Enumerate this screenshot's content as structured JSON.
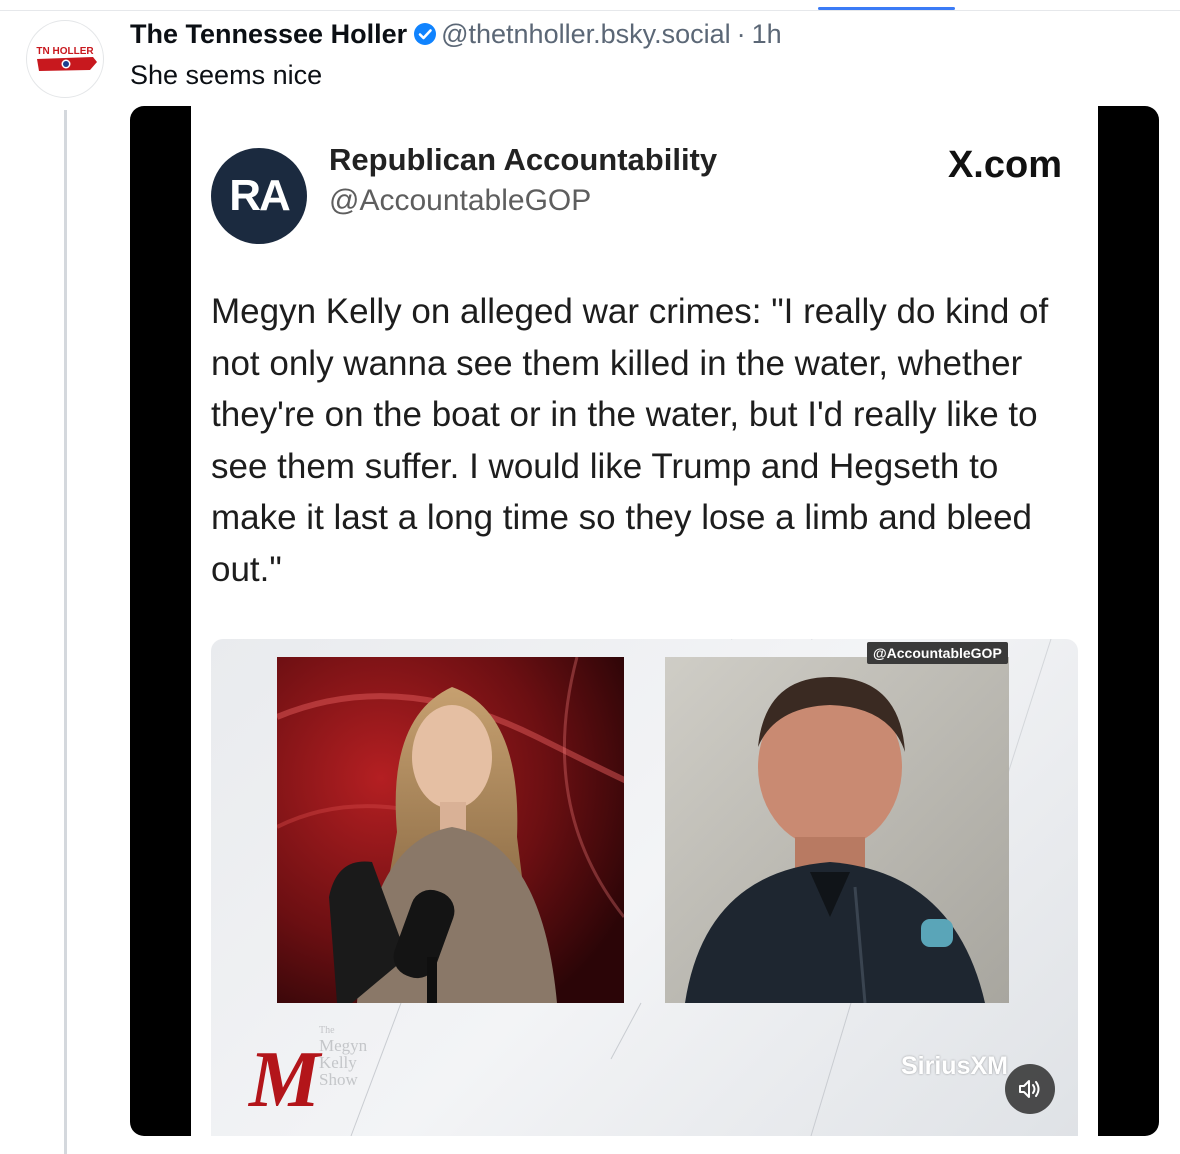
{
  "post": {
    "author": "The Tennessee Holler",
    "handle": "@thetnholler.bsky.social",
    "separator": "·",
    "time": "1h",
    "text": "She seems nice",
    "avatar_text": "TN HOLLER"
  },
  "embed": {
    "account_name": "Republican Accountability",
    "account_handle": "@AccountableGOP",
    "logo_initials": "RA",
    "source": "X.com",
    "tweet_text": "Megyn Kelly on alleged war crimes: \"I really do kind of not only wanna see them killed in the water, whether they're on the boat or in the water, but I'd really like to see them suffer. I would like Trump and Hegseth to make it last a long time so they lose a limb and bleed out.\""
  },
  "video": {
    "watermark": "@AccountableGOP",
    "show_logo_letter": "M",
    "show_logo_lines": [
      "The",
      "Megyn",
      "Kelly",
      "Show"
    ],
    "network": "SiriusXM",
    "mute_icon": "speaker-muted-icon",
    "badge_icon": "blue-badge-icon"
  },
  "colors": {
    "accent": "#3b7bf6",
    "text": "#0b0f14",
    "muted": "#5b6776",
    "ra_logo": "#1b2a3f",
    "mk_red": "#b3151a"
  }
}
